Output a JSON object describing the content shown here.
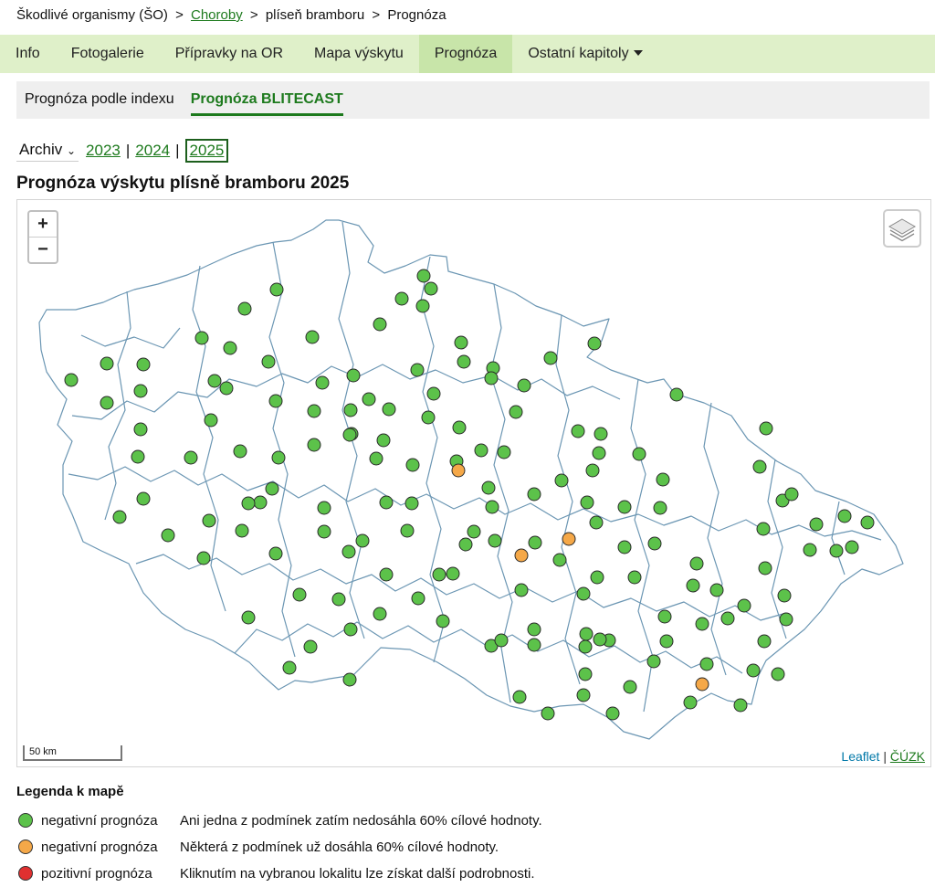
{
  "breadcrumb": {
    "part1": "Škodlivé organismy (ŠO)",
    "sep": ">",
    "part2": "Choroby",
    "part3": "plíseň bramboru",
    "part4": "Prognóza"
  },
  "mainnav": [
    "Info",
    "Fotogalerie",
    "Přípravky na OR",
    "Mapa výskytu",
    "Prognóza",
    "Ostatní kapitoly"
  ],
  "mainnav_active": "Prognóza",
  "subnav": {
    "tab1": "Prognóza podle indexu",
    "tab2": "Prognóza BLITECAST"
  },
  "archive": {
    "label": "Archiv",
    "years": [
      "2023",
      "2024",
      "2025"
    ],
    "current": "2025",
    "separator": "|"
  },
  "title": "Prognóza výskytu plísně bramboru 2025",
  "map": {
    "zoom_in": "+",
    "zoom_out": "−",
    "scale_label": "50 km",
    "attribution": {
      "leaflet": "Leaflet",
      "sep": "|",
      "cuzk": "ČÚZK"
    },
    "colors": {
      "negative": "#5cc24a",
      "warning": "#f5a848",
      "positive": "#e03030",
      "border": "#6b96b3"
    }
  },
  "legend": {
    "title": "Legenda k mapě",
    "items": [
      {
        "label": "negativní prognóza",
        "text": "Ani jedna z podmínek zatím nedosáhla 60% cílové hodnoty.",
        "color": "#5cc24a"
      },
      {
        "label": "negativní prognóza",
        "text": "Některá z podmínek už dosáhla 60% cílové hodnoty.",
        "color": "#f5a848"
      },
      {
        "label": "pozitivní prognóza",
        "text": "Kliknutím na vybranou lokalitu lze získat další podrobnosti.",
        "color": "#e03030"
      }
    ]
  }
}
